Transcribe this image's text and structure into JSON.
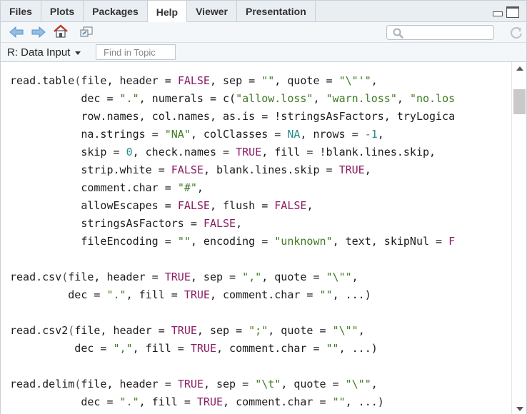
{
  "tabs": [
    {
      "label": "Files",
      "active": false
    },
    {
      "label": "Plots",
      "active": false
    },
    {
      "label": "Packages",
      "active": false
    },
    {
      "label": "Help",
      "active": true
    },
    {
      "label": "Viewer",
      "active": false
    },
    {
      "label": "Presentation",
      "active": false
    }
  ],
  "topic": {
    "label": "R: Data Input"
  },
  "find": {
    "placeholder": "Find in Topic"
  },
  "colors": {
    "keyword": "#8b1d64",
    "string": "#3e7a23",
    "number": "#2a8a8a",
    "home": "#c0392b",
    "nav_arrow": "#6fa8dc"
  },
  "code_lines": [
    [
      [
        "fn",
        "read.table"
      ],
      [
        "punc",
        "("
      ],
      [
        "fn",
        "file, header = "
      ],
      [
        "kw",
        "FALSE"
      ],
      [
        "fn",
        ", sep = "
      ],
      [
        "str",
        "\"\""
      ],
      [
        "fn",
        ", quote = "
      ],
      [
        "str",
        "\"\\\"'\""
      ],
      [
        "fn",
        ","
      ]
    ],
    [
      [
        "fn",
        "           dec = "
      ],
      [
        "str",
        "\".\""
      ],
      [
        "fn",
        ", numerals = c("
      ],
      [
        "str",
        "\"allow.loss\""
      ],
      [
        "fn",
        ", "
      ],
      [
        "str",
        "\"warn.loss\""
      ],
      [
        "fn",
        ", "
      ],
      [
        "str",
        "\"no.los"
      ]
    ],
    [
      [
        "fn",
        "           row.names, col.names, as.is = !stringsAsFactors, tryLogica"
      ]
    ],
    [
      [
        "fn",
        "           na.strings = "
      ],
      [
        "str",
        "\"NA\""
      ],
      [
        "fn",
        ", colClasses = "
      ],
      [
        "num",
        "NA"
      ],
      [
        "fn",
        ", nrows = "
      ],
      [
        "num",
        "-1"
      ],
      [
        "fn",
        ","
      ]
    ],
    [
      [
        "fn",
        "           skip = "
      ],
      [
        "num",
        "0"
      ],
      [
        "fn",
        ", check.names = "
      ],
      [
        "kw",
        "TRUE"
      ],
      [
        "fn",
        ", fill = !blank.lines.skip,"
      ]
    ],
    [
      [
        "fn",
        "           strip.white = "
      ],
      [
        "kw",
        "FALSE"
      ],
      [
        "fn",
        ", blank.lines.skip = "
      ],
      [
        "kw",
        "TRUE"
      ],
      [
        "fn",
        ","
      ]
    ],
    [
      [
        "fn",
        "           comment.char = "
      ],
      [
        "str",
        "\"#\""
      ],
      [
        "fn",
        ","
      ]
    ],
    [
      [
        "fn",
        "           allowEscapes = "
      ],
      [
        "kw",
        "FALSE"
      ],
      [
        "fn",
        ", flush = "
      ],
      [
        "kw",
        "FALSE"
      ],
      [
        "fn",
        ","
      ]
    ],
    [
      [
        "fn",
        "           stringsAsFactors = "
      ],
      [
        "kw",
        "FALSE"
      ],
      [
        "fn",
        ","
      ]
    ],
    [
      [
        "fn",
        "           fileEncoding = "
      ],
      [
        "str",
        "\"\""
      ],
      [
        "fn",
        ", encoding = "
      ],
      [
        "str",
        "\"unknown\""
      ],
      [
        "fn",
        ", text, skipNul = "
      ],
      [
        "kw",
        "F"
      ]
    ],
    [],
    [
      [
        "fn",
        "read.csv"
      ],
      [
        "punc",
        "("
      ],
      [
        "fn",
        "file, header = "
      ],
      [
        "kw",
        "TRUE"
      ],
      [
        "fn",
        ", sep = "
      ],
      [
        "str",
        "\",\""
      ],
      [
        "fn",
        ", quote = "
      ],
      [
        "str",
        "\"\\\"\""
      ],
      [
        "fn",
        ","
      ]
    ],
    [
      [
        "fn",
        "         dec = "
      ],
      [
        "str",
        "\".\""
      ],
      [
        "fn",
        ", fill = "
      ],
      [
        "kw",
        "TRUE"
      ],
      [
        "fn",
        ", comment.char = "
      ],
      [
        "str",
        "\"\""
      ],
      [
        "fn",
        ", ...)"
      ]
    ],
    [],
    [
      [
        "fn",
        "read.csv2"
      ],
      [
        "punc",
        "("
      ],
      [
        "fn",
        "file, header = "
      ],
      [
        "kw",
        "TRUE"
      ],
      [
        "fn",
        ", sep = "
      ],
      [
        "str",
        "\";\""
      ],
      [
        "fn",
        ", quote = "
      ],
      [
        "str",
        "\"\\\"\""
      ],
      [
        "fn",
        ","
      ]
    ],
    [
      [
        "fn",
        "          dec = "
      ],
      [
        "str",
        "\",\""
      ],
      [
        "fn",
        ", fill = "
      ],
      [
        "kw",
        "TRUE"
      ],
      [
        "fn",
        ", comment.char = "
      ],
      [
        "str",
        "\"\""
      ],
      [
        "fn",
        ", ...)"
      ]
    ],
    [],
    [
      [
        "fn",
        "read.delim"
      ],
      [
        "punc",
        "("
      ],
      [
        "fn",
        "file, header = "
      ],
      [
        "kw",
        "TRUE"
      ],
      [
        "fn",
        ", sep = "
      ],
      [
        "str",
        "\"\\t\""
      ],
      [
        "fn",
        ", quote = "
      ],
      [
        "str",
        "\"\\\"\""
      ],
      [
        "fn",
        ","
      ]
    ],
    [
      [
        "fn",
        "           dec = "
      ],
      [
        "str",
        "\".\""
      ],
      [
        "fn",
        ", fill = "
      ],
      [
        "kw",
        "TRUE"
      ],
      [
        "fn",
        ", comment.char = "
      ],
      [
        "str",
        "\"\""
      ],
      [
        "fn",
        ", ...)"
      ]
    ]
  ]
}
